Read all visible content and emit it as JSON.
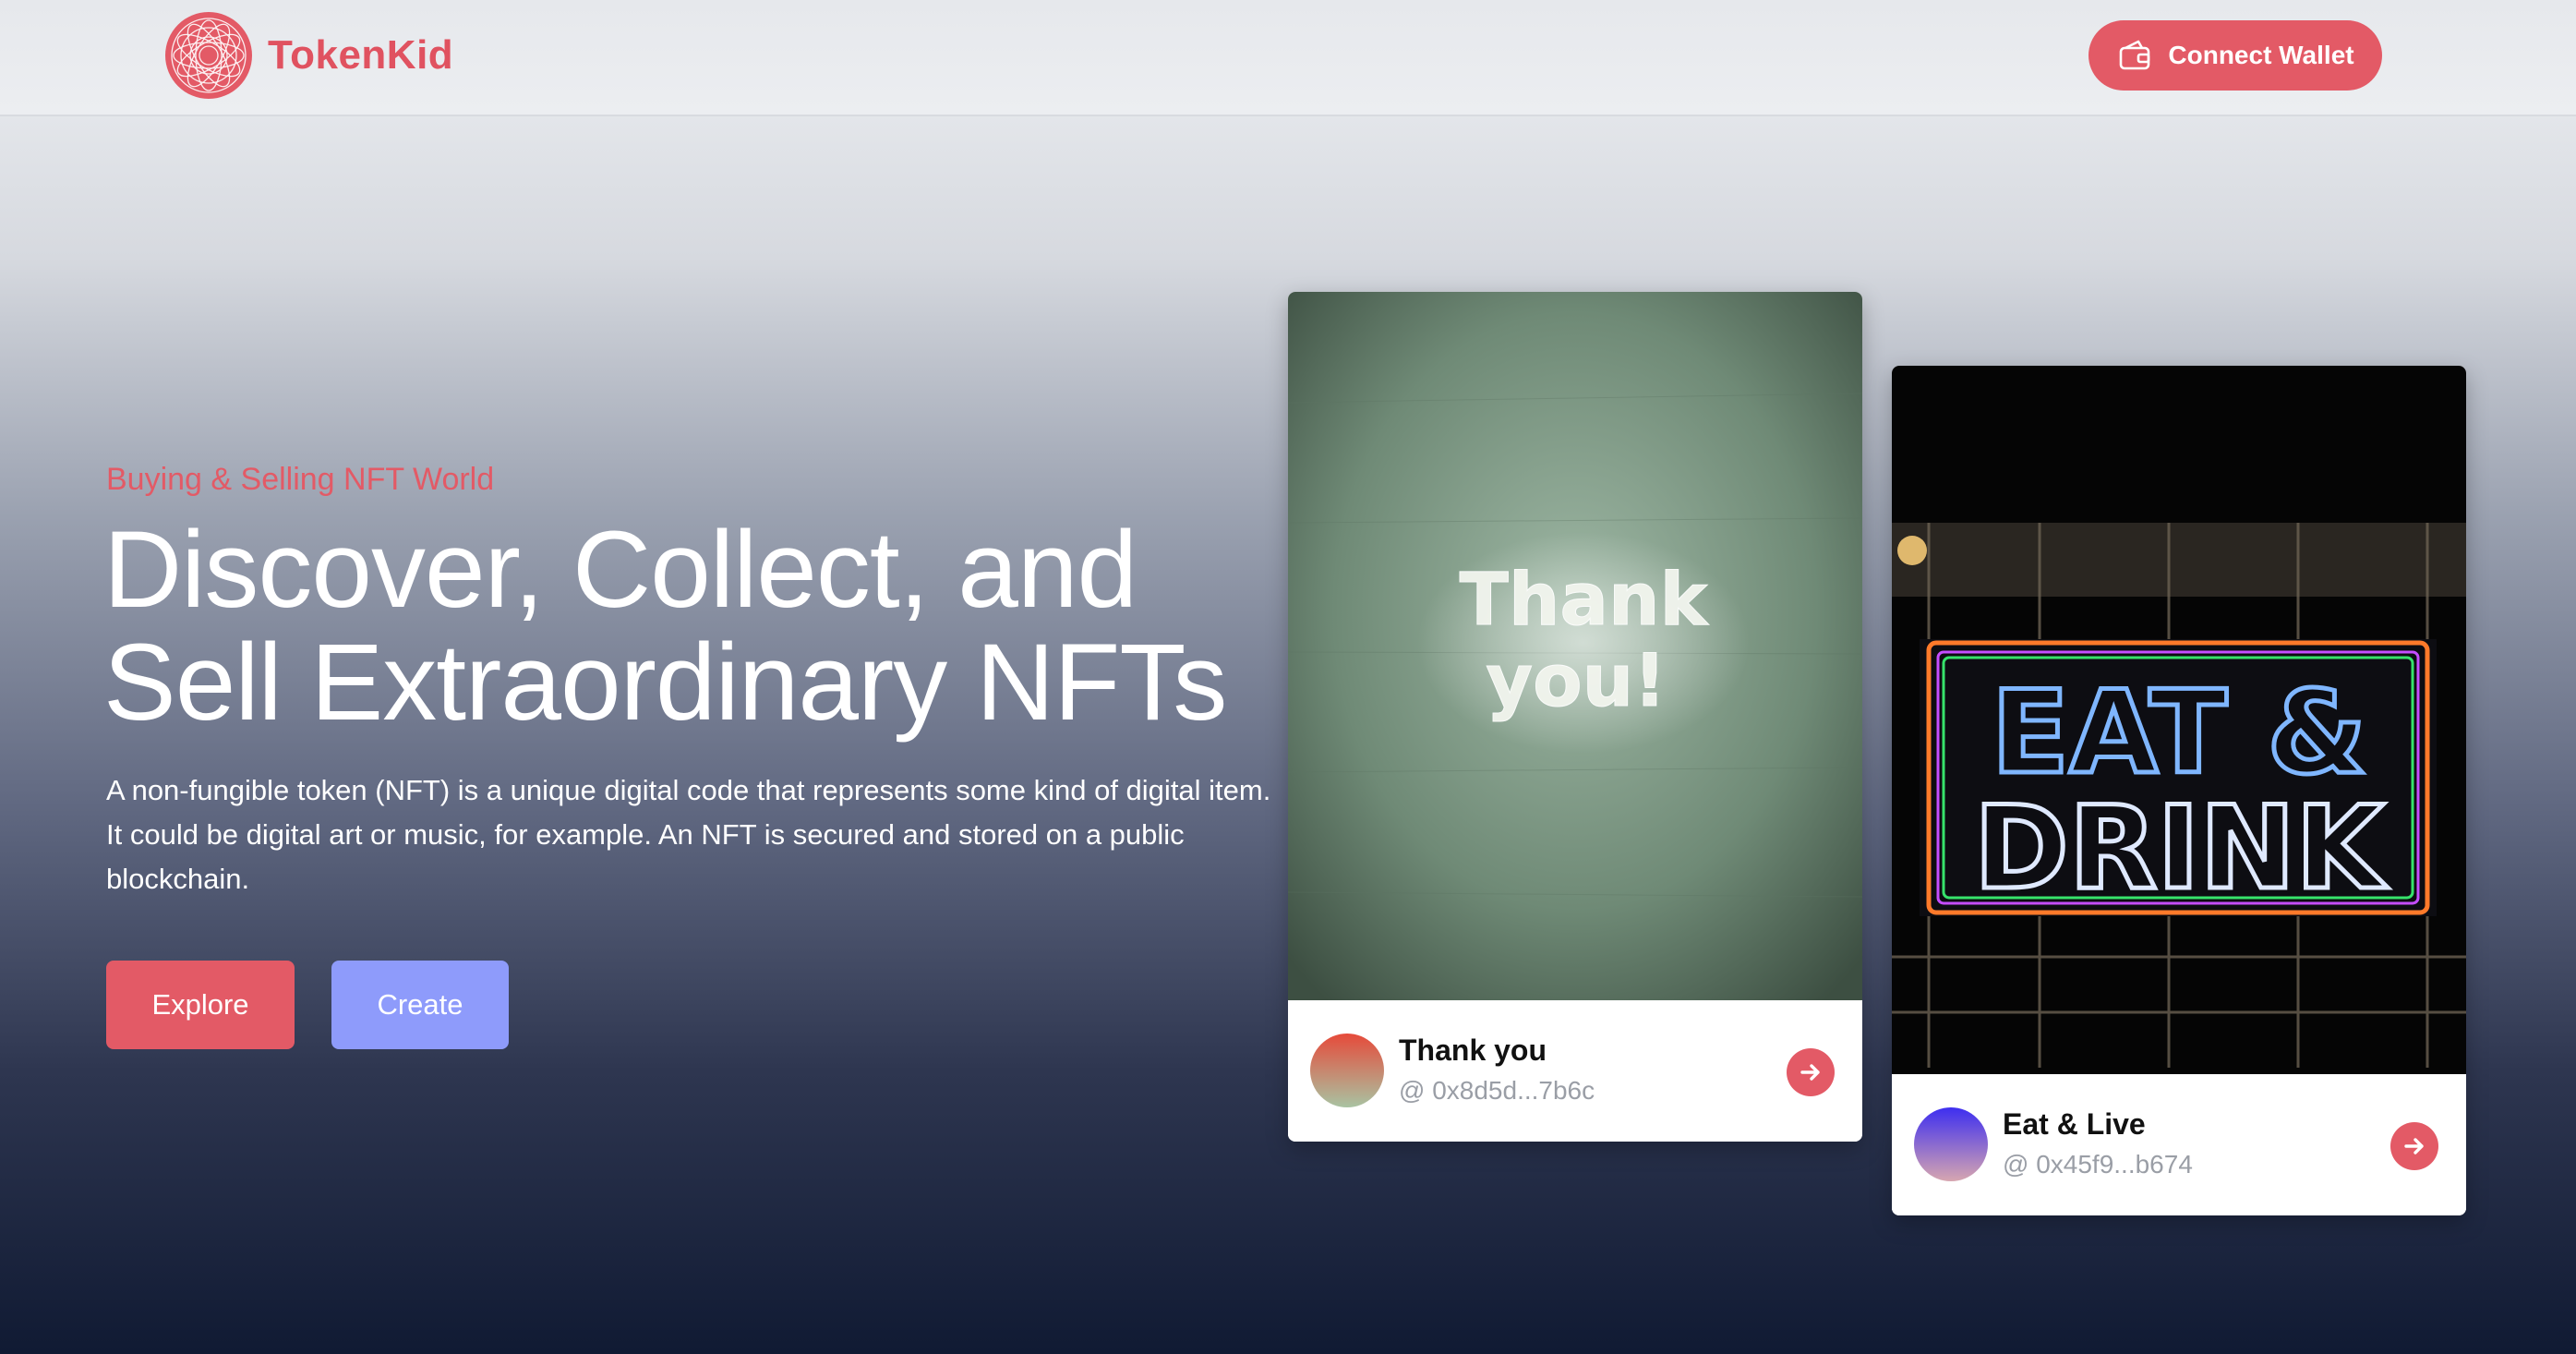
{
  "brand": {
    "name": "TokenKid",
    "accent": "#e35a66"
  },
  "header": {
    "connect_label": "Connect Wallet"
  },
  "hero": {
    "eyebrow": "Buying & Selling NFT World",
    "headline_line1": "Discover, Collect, and",
    "headline_line2": "Sell Extraordinary NFTs",
    "description": "A non-fungible token (NFT) is a unique digital code that represents some kind of digital item. It could be digital art or music, for example. An NFT is secured and stored on a public blockchain.",
    "explore_label": "Explore",
    "create_label": "Create",
    "create_color": "#8e9bfb"
  },
  "cards": [
    {
      "title": "Thank you",
      "address": "@ 0x8d5d...7b6c",
      "sign_line1": "Thank",
      "sign_line2": "you!"
    },
    {
      "title": "Eat & Live",
      "address": "@ 0x45f9...b674",
      "sign_line1": "EAT &",
      "sign_line2": "DRINK"
    }
  ],
  "icons": [
    "logo-mandala-icon",
    "wallet-icon",
    "arrow-right-icon"
  ]
}
